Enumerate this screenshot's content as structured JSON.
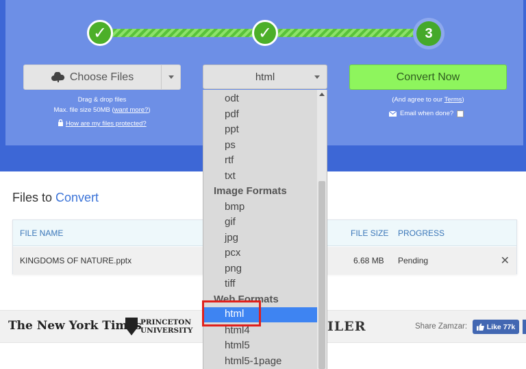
{
  "steps": [
    {
      "label": "✓",
      "state": "done"
    },
    {
      "label": "✓",
      "state": "done"
    },
    {
      "label": "3",
      "state": "current"
    }
  ],
  "upload": {
    "choose_files_label": "Choose Files",
    "icon": "cloud-upload-icon",
    "drag_drop": "Drag & drop files",
    "max_size": "Max. file size 50MB (",
    "want_more": "want more?",
    "max_size_close": ")",
    "protected_link": "How are my files protected?",
    "lock_icon": "lock-icon"
  },
  "format": {
    "selected": "html",
    "options": [
      {
        "type": "item",
        "label": "odt"
      },
      {
        "type": "item",
        "label": "pdf"
      },
      {
        "type": "item",
        "label": "ppt"
      },
      {
        "type": "item",
        "label": "ps"
      },
      {
        "type": "item",
        "label": "rtf"
      },
      {
        "type": "item",
        "label": "txt"
      },
      {
        "type": "group",
        "label": "Image Formats"
      },
      {
        "type": "item",
        "label": "bmp"
      },
      {
        "type": "item",
        "label": "gif"
      },
      {
        "type": "item",
        "label": "jpg"
      },
      {
        "type": "item",
        "label": "pcx"
      },
      {
        "type": "item",
        "label": "png"
      },
      {
        "type": "item",
        "label": "tiff"
      },
      {
        "type": "group",
        "label": "Web Formats"
      },
      {
        "type": "item",
        "label": "html",
        "selected": true
      },
      {
        "type": "item",
        "label": "html4"
      },
      {
        "type": "item",
        "label": "html5"
      },
      {
        "type": "item",
        "label": "html5-1page"
      }
    ]
  },
  "convert": {
    "button_label": "Convert Now",
    "agree_prefix": "(And agree to our ",
    "terms_link": "Terms",
    "agree_suffix": ")",
    "email_label": "Email when done?",
    "email_checked": false
  },
  "files": {
    "title_prefix": "Files to ",
    "title_accent": "Convert",
    "columns": {
      "name": "FILE NAME",
      "size": "FILE SIZE",
      "progress": "PROGRESS"
    },
    "rows": [
      {
        "name": "KINGDOMS OF NATURE.pptx",
        "size": "6.68 MB",
        "progress": "Pending",
        "remove": "✕"
      }
    ]
  },
  "press": {
    "nyt": "The New York Times",
    "princeton_line1": "PRINCETON",
    "princeton_line2": "UNIVERSITY",
    "partial_logo": "ILER",
    "share_label": "Share Zamzar:",
    "like_label": "Like 77k"
  },
  "colors": {
    "hero_bg": "#3d67d6",
    "hero_panel": "#6d8fe6",
    "step_done": "#4caf29",
    "convert_btn": "#8ef55d",
    "accent_blue": "#3c74d8",
    "selected_option": "#3e84f2",
    "highlight_red": "#e0201b",
    "facebook": "#4267b2"
  }
}
